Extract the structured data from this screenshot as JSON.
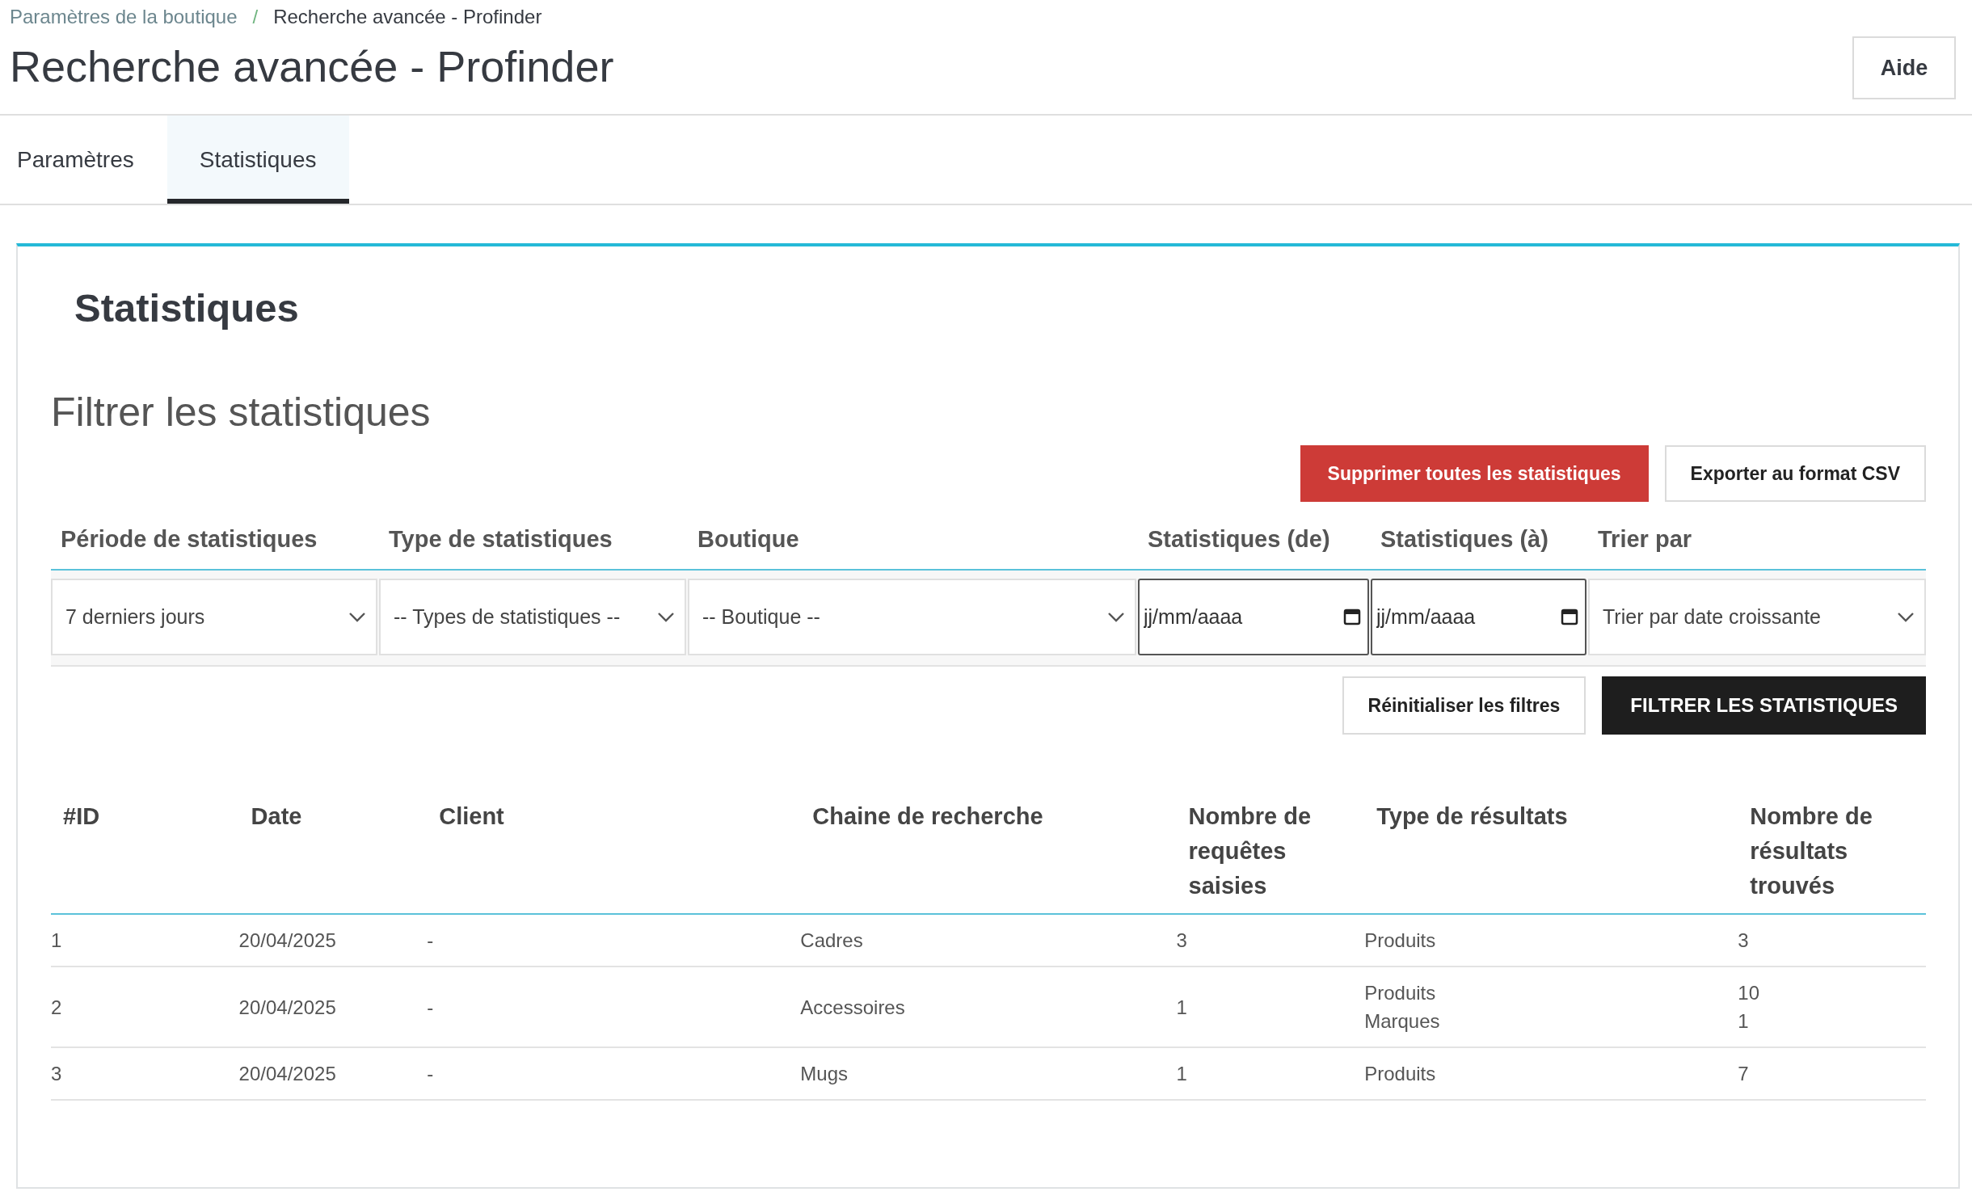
{
  "breadcrumb": {
    "items": [
      {
        "label": "Paramètres de la boutique",
        "kind": "link"
      },
      {
        "label": "Recherche avancée - Profinder",
        "kind": "current"
      }
    ],
    "separator": "/"
  },
  "page_title": "Recherche avancée - Profinder",
  "help_button": "Aide",
  "tabs": [
    {
      "label": "Paramètres",
      "selected": false
    },
    {
      "label": "Statistiques",
      "selected": true
    }
  ],
  "card": {
    "title": "Statistiques",
    "section_title": "Filtrer les statistiques",
    "actions": [
      {
        "label": "Supprimer toutes les statistiques",
        "kind": "danger"
      },
      {
        "label": "Exporter au format CSV",
        "kind": "outline"
      }
    ],
    "filters": [
      {
        "label": "Période de statistiques",
        "kind": "select",
        "value": "7 derniers jours"
      },
      {
        "label": "Type de statistiques",
        "kind": "select",
        "value": "-- Types de statistiques --"
      },
      {
        "label": "Boutique",
        "kind": "select",
        "value": "-- Boutique --"
      },
      {
        "label": "Statistiques (de)",
        "kind": "date",
        "placeholder": "jj/mm/aaaa"
      },
      {
        "label": "Statistiques (à)",
        "kind": "date",
        "placeholder": "jj/mm/aaaa"
      },
      {
        "label": "Trier par",
        "kind": "select",
        "value": "Trier par date croissante"
      }
    ],
    "filter_buttons": [
      {
        "label": "Réinitialiser les filtres",
        "kind": "outline"
      },
      {
        "label": "FILTRER LES STATISTIQUES",
        "kind": "dark"
      }
    ],
    "table": {
      "columns": [
        "#ID",
        "Date",
        "Client",
        "Chaine de recherche",
        "Nombre de requêtes saisies",
        "Type de résultats",
        "Nombre de résultats trouvés"
      ],
      "rows": [
        {
          "id": "1",
          "date": "20/04/2025",
          "client": "-",
          "search": "Cadres",
          "requests": "3",
          "result_types": [
            "Produits"
          ],
          "result_counts": [
            "3"
          ]
        },
        {
          "id": "2",
          "date": "20/04/2025",
          "client": "-",
          "search": "Accessoires",
          "requests": "1",
          "result_types": [
            "Produits",
            "Marques"
          ],
          "result_counts": [
            "10",
            "1"
          ]
        },
        {
          "id": "3",
          "date": "20/04/2025",
          "client": "-",
          "search": "Mugs",
          "requests": "1",
          "result_types": [
            "Produits"
          ],
          "result_counts": [
            "7"
          ]
        }
      ]
    }
  }
}
